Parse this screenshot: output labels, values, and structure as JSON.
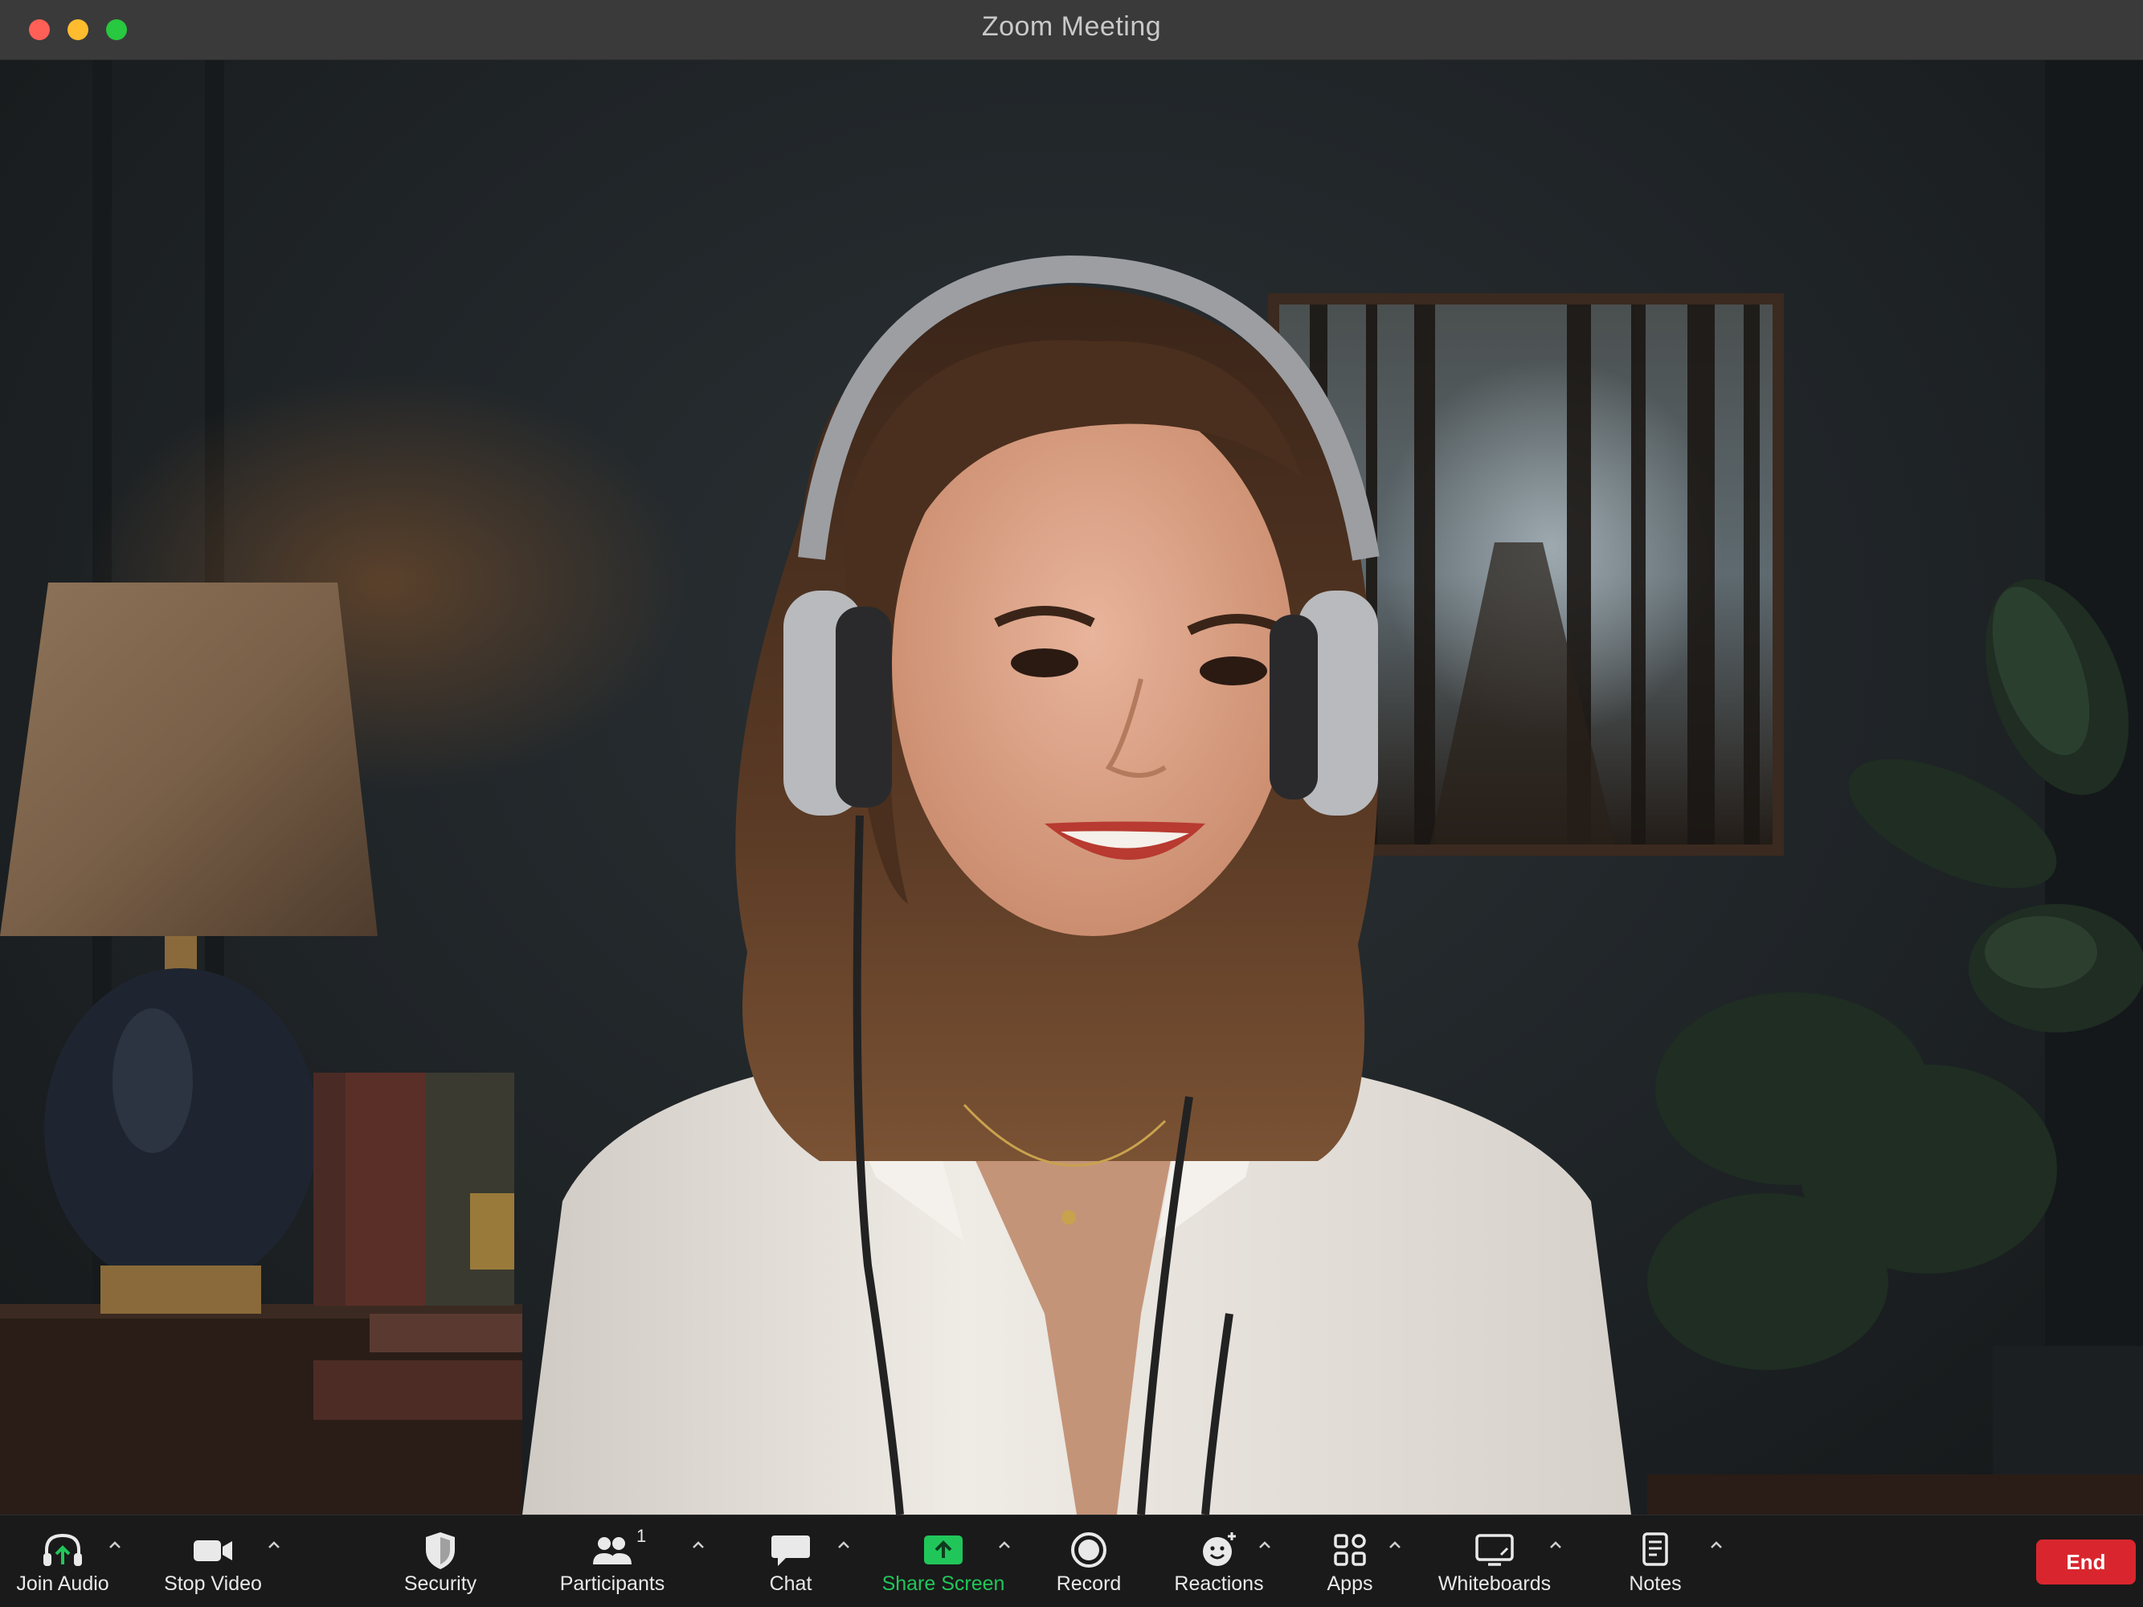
{
  "window": {
    "title": "Zoom Meeting"
  },
  "toolbar": {
    "join_audio": "Join Audio",
    "stop_video": "Stop Video",
    "security": "Security",
    "participants": "Participants",
    "participants_count": "1",
    "chat": "Chat",
    "share_screen": "Share Screen",
    "record": "Record",
    "reactions": "Reactions",
    "apps": "Apps",
    "whiteboards": "Whiteboards",
    "notes": "Notes",
    "end": "End"
  },
  "colors": {
    "share_screen_accent": "#21c65a",
    "end_button": "#d9262e",
    "titlebar": "#3a3a3a",
    "toolbar": "#1a1a1a"
  },
  "icons": {
    "join_audio": "headphones-icon",
    "stop_video": "video-camera-icon",
    "security": "shield-icon",
    "participants": "people-icon",
    "chat": "chat-bubble-icon",
    "share_screen": "share-arrow-icon",
    "record": "record-icon",
    "reactions": "smiley-icon",
    "apps": "apps-icon",
    "whiteboards": "whiteboard-icon",
    "notes": "notes-icon"
  }
}
